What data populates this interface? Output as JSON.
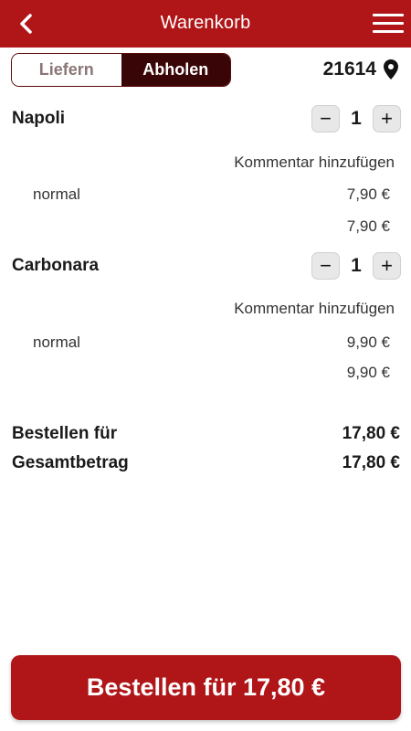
{
  "header": {
    "title": "Warenkorb"
  },
  "delivery_toggle": {
    "options": [
      "Liefern",
      "Abholen"
    ],
    "selected": "Abholen"
  },
  "location": {
    "zip": "21614"
  },
  "cart": {
    "items": [
      {
        "name": "Napoli",
        "quantity": "1",
        "comment_label": "Kommentar hinzufügen",
        "variant": "normal",
        "variant_price": "7,90 €",
        "total": "7,90 €"
      },
      {
        "name": "Carbonara",
        "quantity": "1",
        "comment_label": "Kommentar hinzufügen",
        "variant": "normal",
        "variant_price": "9,90 €",
        "total": "9,90 €"
      }
    ]
  },
  "stepper": {
    "minus": "−",
    "plus": "+"
  },
  "summary": {
    "order_for_label": "Bestellen für",
    "order_for_value": "17,80 €",
    "total_label": "Gesamtbetrag",
    "total_value": "17,80 €"
  },
  "order_button": {
    "label": "Bestellen für 17,80 €"
  },
  "colors": {
    "brand": "#b01518",
    "toggle_active": "#3a0506"
  }
}
